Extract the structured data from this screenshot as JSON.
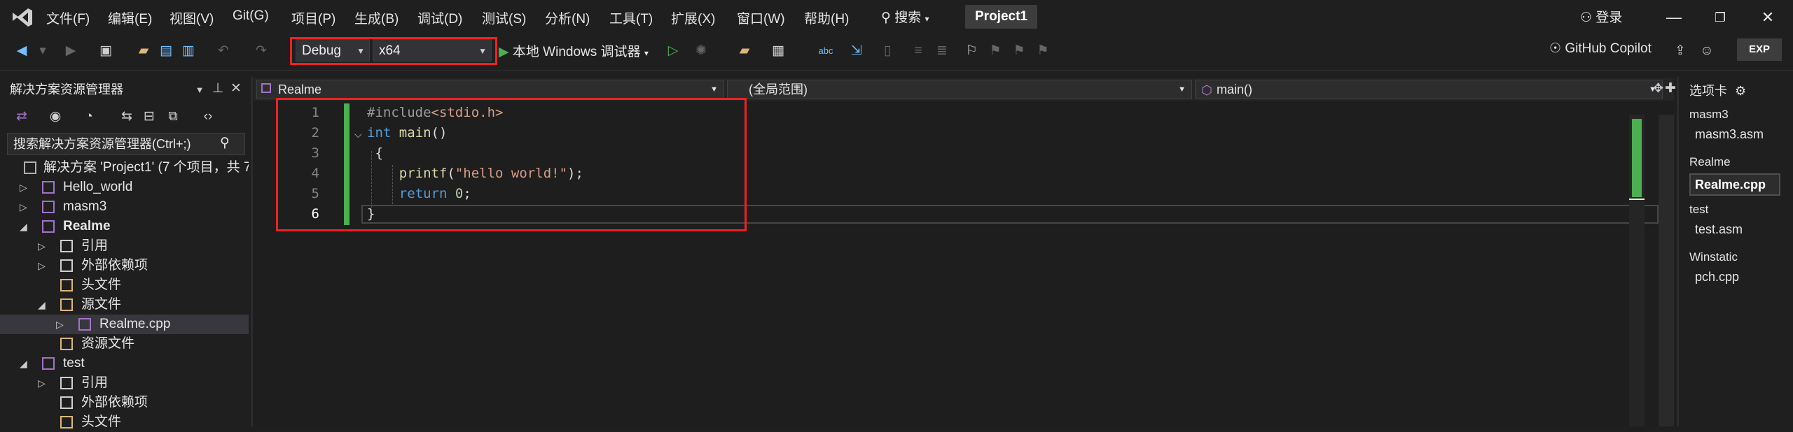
{
  "menu": [
    "文件(F)",
    "编辑(E)",
    "视图(V)",
    "Git(G)",
    "项目(P)",
    "生成(B)",
    "调试(D)",
    "测试(S)",
    "分析(N)",
    "工具(T)",
    "扩展(X)",
    "窗口(W)",
    "帮助(H)"
  ],
  "search_label": "搜索",
  "project_name": "Project1",
  "login_label": "登录",
  "toolbar": {
    "config": "Debug",
    "platform": "x64",
    "run_label": "本地 Windows 调试器",
    "copilot_label": "GitHub Copilot",
    "exp_label": "EXP"
  },
  "solution_explorer": {
    "title": "解决方案资源管理器",
    "search_placeholder": "搜索解决方案资源管理器(Ctrl+;)",
    "solution_label": "解决方案 'Project1' (7 个项目，共 7",
    "items": [
      {
        "label": "Hello_world",
        "depth": 1,
        "expander": "collapsed",
        "icon": "project-icon"
      },
      {
        "label": "masm3",
        "depth": 1,
        "expander": "collapsed",
        "icon": "project-icon"
      },
      {
        "label": "Realme",
        "depth": 1,
        "expander": "expanded",
        "icon": "project-icon",
        "bold": true
      },
      {
        "label": "引用",
        "depth": 2,
        "expander": "collapsed",
        "icon": "references-icon"
      },
      {
        "label": "外部依赖项",
        "depth": 2,
        "expander": "collapsed",
        "icon": "external-deps-icon"
      },
      {
        "label": "头文件",
        "depth": 2,
        "expander": "none",
        "icon": "filter-folder-icon"
      },
      {
        "label": "源文件",
        "depth": 2,
        "expander": "expanded",
        "icon": "filter-folder-icon"
      },
      {
        "label": "Realme.cpp",
        "depth": 3,
        "expander": "collapsed",
        "icon": "cpp-file-icon",
        "selected": true
      },
      {
        "label": "资源文件",
        "depth": 2,
        "expander": "none",
        "icon": "filter-folder-icon"
      },
      {
        "label": "test",
        "depth": 1,
        "expander": "expanded",
        "icon": "project-icon"
      },
      {
        "label": "引用",
        "depth": 2,
        "expander": "collapsed",
        "icon": "references-icon"
      },
      {
        "label": "外部依赖项",
        "depth": 2,
        "expander": "none",
        "icon": "external-deps-icon"
      },
      {
        "label": "头文件",
        "depth": 2,
        "expander": "none",
        "icon": "filter-folder-icon"
      }
    ]
  },
  "editor": {
    "nav_project": "Realme",
    "nav_scope": "(全局范围)",
    "nav_member": "main()",
    "line_numbers": [
      "1",
      "2",
      "3",
      "4",
      "5",
      "6"
    ],
    "current_line": "6"
  },
  "tabs_panel": {
    "title": "选项卡",
    "groups": [
      {
        "name": "masm3",
        "file": "masm3.asm"
      },
      {
        "name": "Realme",
        "file": "Realme.cpp",
        "active": true
      },
      {
        "name": "test",
        "file": "test.asm"
      },
      {
        "name": "Winstatic",
        "file": "pch.cpp"
      }
    ]
  },
  "colors": {
    "highlight_red": "#ee2222",
    "keyword": "#569cd6",
    "function": "#dcdcaa",
    "string": "#d69d85",
    "text": "#dcdcdc",
    "change_bar": "#4caf50"
  }
}
